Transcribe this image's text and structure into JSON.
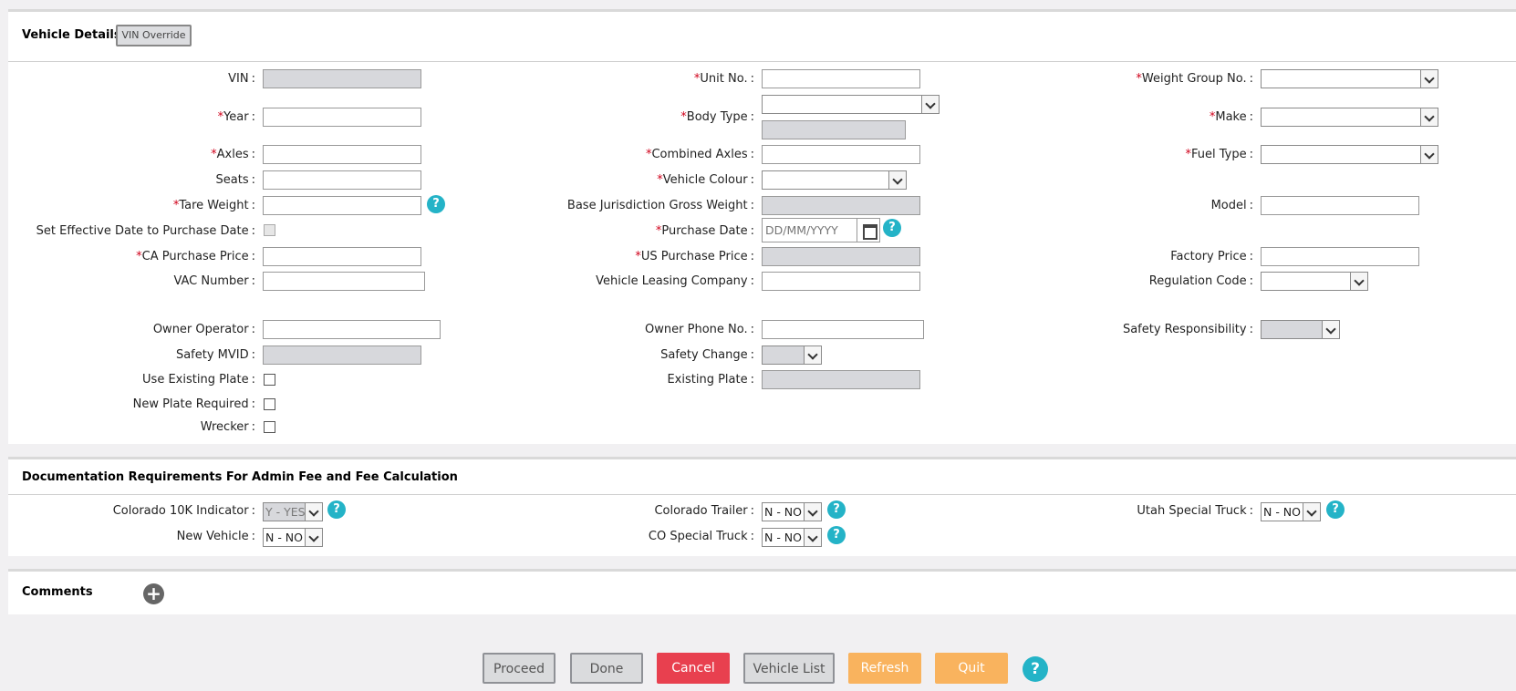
{
  "vehicle_details": {
    "title": "Vehicle Details",
    "vin_override": "VIN Override",
    "fields": {
      "vin": {
        "label": "VIN",
        "value": ""
      },
      "unit_no": {
        "label": "Unit No.",
        "value": ""
      },
      "weight_group_no": {
        "label": "Weight Group No.",
        "value": ""
      },
      "year": {
        "label": "Year",
        "value": ""
      },
      "body_type": {
        "label": "Body Type",
        "value": ""
      },
      "make": {
        "label": "Make",
        "value": ""
      },
      "axles": {
        "label": "Axles",
        "value": ""
      },
      "combined_axles": {
        "label": "Combined Axles",
        "value": ""
      },
      "fuel_type": {
        "label": "Fuel Type",
        "value": ""
      },
      "seats": {
        "label": "Seats",
        "value": ""
      },
      "vehicle_colour": {
        "label": "Vehicle Colour",
        "value": ""
      },
      "tare_weight": {
        "label": "Tare Weight",
        "value": ""
      },
      "base_jurisdiction_gross_weight": {
        "label": "Base Jurisdiction Gross Weight",
        "value": ""
      },
      "model": {
        "label": "Model",
        "value": ""
      },
      "set_effective_date": {
        "label": "Set Effective Date to Purchase Date",
        "checked": false
      },
      "purchase_date": {
        "label": "Purchase Date",
        "placeholder": "DD/MM/YYYY"
      },
      "ca_purchase_price": {
        "label": "CA Purchase Price",
        "value": ""
      },
      "us_purchase_price": {
        "label": "US Purchase Price",
        "value": ""
      },
      "factory_price": {
        "label": "Factory Price",
        "value": ""
      },
      "vac_number": {
        "label": "VAC Number",
        "value": ""
      },
      "vehicle_leasing_company": {
        "label": "Vehicle Leasing Company",
        "value": ""
      },
      "regulation_code": {
        "label": "Regulation Code",
        "value": ""
      },
      "owner_operator": {
        "label": "Owner Operator",
        "value": ""
      },
      "owner_phone_no": {
        "label": "Owner Phone No.",
        "value": ""
      },
      "safety_responsibility": {
        "label": "Safety Responsibility",
        "value": ""
      },
      "safety_mvid": {
        "label": "Safety MVID",
        "value": ""
      },
      "safety_change": {
        "label": "Safety Change",
        "value": ""
      },
      "use_existing_plate": {
        "label": "Use Existing Plate",
        "checked": false
      },
      "existing_plate": {
        "label": "Existing Plate",
        "value": ""
      },
      "new_plate_required": {
        "label": "New Plate Required",
        "checked": false
      },
      "wrecker": {
        "label": "Wrecker",
        "checked": false
      }
    }
  },
  "documentation": {
    "title": "Documentation Requirements For Admin Fee and Fee Calculation",
    "fields": {
      "colorado_10k": {
        "label": "Colorado 10K Indicator",
        "value": "Y - YES"
      },
      "colorado_trailer": {
        "label": "Colorado Trailer",
        "value": "N - NO"
      },
      "utah_special_truck": {
        "label": "Utah Special Truck",
        "value": "N - NO"
      },
      "new_vehicle": {
        "label": "New Vehicle",
        "value": "N - NO"
      },
      "co_special_truck": {
        "label": "CO Special Truck",
        "value": "N - NO"
      }
    }
  },
  "comments": {
    "title": "Comments"
  },
  "actions": {
    "proceed": "Proceed",
    "done": "Done",
    "cancel": "Cancel",
    "vehicle_list": "Vehicle List",
    "refresh": "Refresh",
    "quit": "Quit"
  },
  "common": {
    "required_mark": "*",
    "colon": ":",
    "help_glyph": "?",
    "plus_glyph": "+"
  },
  "colors": {
    "required": "#d0021b",
    "help": "#24b3c7",
    "cancel": "#e8404f",
    "orange": "#f9b35e"
  }
}
